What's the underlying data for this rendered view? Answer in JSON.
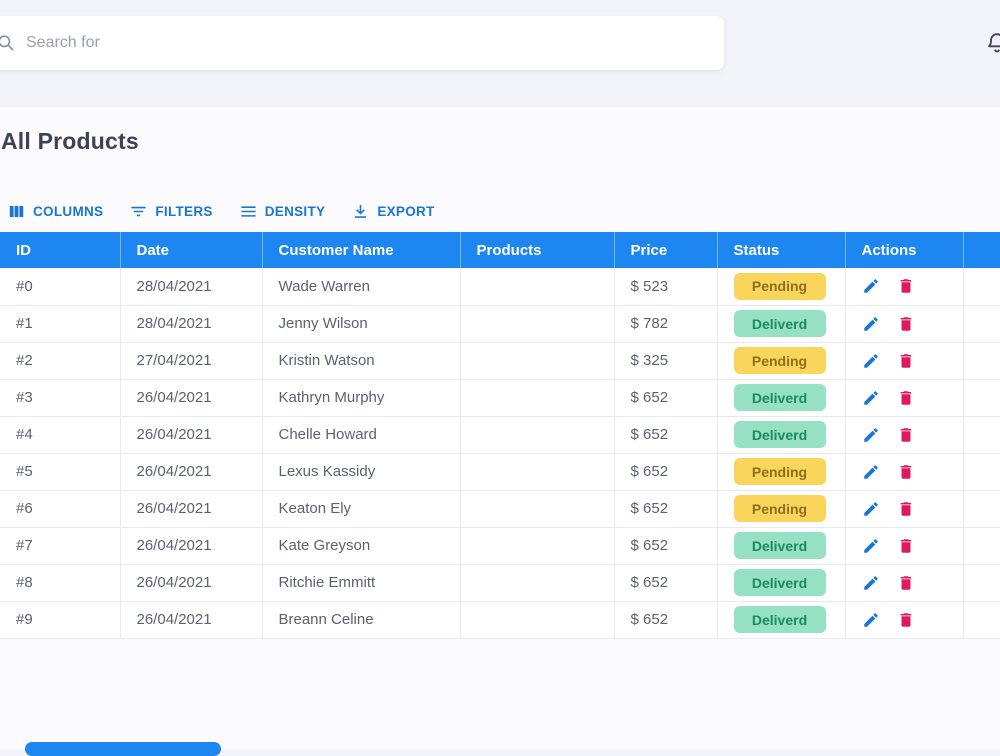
{
  "topbar": {
    "search_placeholder": "Search for"
  },
  "page": {
    "title": "All Products"
  },
  "toolbar": {
    "columns": "COLUMNS",
    "filters": "FILTERS",
    "density": "DENSITY",
    "export": "EXPORT"
  },
  "table": {
    "headers": [
      "ID",
      "Date",
      "Customer Name",
      "Products",
      "Price",
      "Status",
      "Actions"
    ],
    "rows": [
      {
        "id": "#0",
        "date": "28/04/2021",
        "customer": "Wade Warren",
        "products": "",
        "price": "$ 523",
        "status": "Pending"
      },
      {
        "id": "#1",
        "date": "28/04/2021",
        "customer": "Jenny Wilson",
        "products": "",
        "price": "$ 782",
        "status": "Deliverd"
      },
      {
        "id": "#2",
        "date": "27/04/2021",
        "customer": "Kristin Watson",
        "products": "",
        "price": "$ 325",
        "status": "Pending"
      },
      {
        "id": "#3",
        "date": "26/04/2021",
        "customer": "Kathryn Murphy",
        "products": "",
        "price": "$ 652",
        "status": "Deliverd"
      },
      {
        "id": "#4",
        "date": "26/04/2021",
        "customer": "Chelle Howard",
        "products": "",
        "price": "$ 652",
        "status": "Deliverd"
      },
      {
        "id": "#5",
        "date": "26/04/2021",
        "customer": "Lexus Kassidy",
        "products": "",
        "price": "$ 652",
        "status": "Pending"
      },
      {
        "id": "#6",
        "date": "26/04/2021",
        "customer": "Keaton Ely",
        "products": "",
        "price": "$ 652",
        "status": "Pending"
      },
      {
        "id": "#7",
        "date": "26/04/2021",
        "customer": "Kate Greyson",
        "products": "",
        "price": "$ 652",
        "status": "Deliverd"
      },
      {
        "id": "#8",
        "date": "26/04/2021",
        "customer": "Ritchie Emmitt",
        "products": "",
        "price": "$ 652",
        "status": "Deliverd"
      },
      {
        "id": "#9",
        "date": "26/04/2021",
        "customer": "Breann Celine",
        "products": "",
        "price": "$ 652",
        "status": "Deliverd"
      }
    ]
  },
  "icons": {
    "search": "magnifier",
    "notifications": "bell",
    "columns": "three-vertical-bars",
    "filters": "funnel-lines",
    "density": "horizontal-lines",
    "export": "download-arrow",
    "edit": "pencil",
    "delete": "trash"
  },
  "colors": {
    "header_bg": "#1d86f0",
    "accent": "#1976d2",
    "danger": "#e0195f",
    "pending_bg": "#f9d65b",
    "pending_text": "#8f6e1f",
    "delivered_bg": "#96e0c3",
    "delivered_text": "#1b8a60",
    "title_text": "#3d4254",
    "body_text": "#5a6170"
  }
}
